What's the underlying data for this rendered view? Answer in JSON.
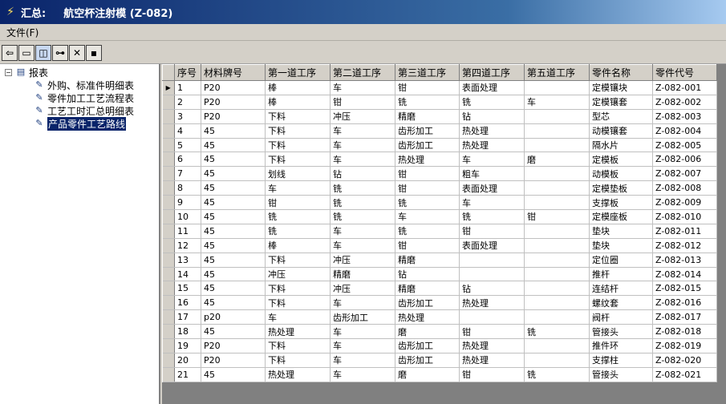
{
  "window": {
    "label": "汇总:",
    "title": "航空杯注射模 (Z-082)"
  },
  "menu": {
    "file": "文件(F)"
  },
  "tree": {
    "root": "报表",
    "children": [
      "外购、标准件明细表",
      "零件加工工艺流程表",
      "工艺工时汇总明细表",
      "产品零件工艺路线"
    ],
    "selected_index": 3
  },
  "grid": {
    "columns": [
      "序号",
      "材料牌号",
      "第一道工序",
      "第二道工序",
      "第三道工序",
      "第四道工序",
      "第五道工序",
      "零件名称",
      "零件代号"
    ],
    "rows": [
      [
        "1",
        "P20",
        "棒",
        "车",
        "钳",
        "表面处理",
        "",
        "定模镶块",
        "Z-082-001"
      ],
      [
        "2",
        "P20",
        "棒",
        "钳",
        "铣",
        "铣",
        "车",
        "定模镶套",
        "Z-082-002"
      ],
      [
        "3",
        "P20",
        "下料",
        "冲压",
        "精磨",
        "钻",
        "",
        "型芯",
        "Z-082-003"
      ],
      [
        "4",
        "45",
        "下料",
        "车",
        "齿形加工",
        "热处理",
        "",
        "动模镶套",
        "Z-082-004"
      ],
      [
        "5",
        "45",
        "下料",
        "车",
        "齿形加工",
        "热处理",
        "",
        "隔水片",
        "Z-082-005"
      ],
      [
        "6",
        "45",
        "下料",
        "车",
        "热处理",
        "车",
        "磨",
        "定模板",
        "Z-082-006"
      ],
      [
        "7",
        "45",
        "划线",
        "钻",
        "钳",
        "粗车",
        "",
        "动模板",
        "Z-082-007"
      ],
      [
        "8",
        "45",
        "车",
        "铣",
        "钳",
        "表面处理",
        "",
        "定模垫板",
        "Z-082-008"
      ],
      [
        "9",
        "45",
        "钳",
        "铣",
        "铣",
        "车",
        "",
        "支撑板",
        "Z-082-009"
      ],
      [
        "10",
        "45",
        "铣",
        "铣",
        "车",
        "铣",
        "钳",
        "定模座板",
        "Z-082-010"
      ],
      [
        "11",
        "45",
        "铣",
        "车",
        "铣",
        "钳",
        "",
        "垫块",
        "Z-082-011"
      ],
      [
        "12",
        "45",
        "棒",
        "车",
        "钳",
        "表面处理",
        "",
        "垫块",
        "Z-082-012"
      ],
      [
        "13",
        "45",
        "下料",
        "冲压",
        "精磨",
        "",
        "",
        "定位圈",
        "Z-082-013"
      ],
      [
        "14",
        "45",
        "冲压",
        "精磨",
        "钻",
        "",
        "",
        "推杆",
        "Z-082-014"
      ],
      [
        "15",
        "45",
        "下料",
        "冲压",
        "精磨",
        "钻",
        "",
        "连结杆",
        "Z-082-015"
      ],
      [
        "16",
        "45",
        "下料",
        "车",
        "齿形加工",
        "热处理",
        "",
        "螺纹套",
        "Z-082-016"
      ],
      [
        "17",
        "p20",
        "车",
        "齿形加工",
        "热处理",
        "",
        "",
        "阀杆",
        "Z-082-017"
      ],
      [
        "18",
        "45",
        "热处理",
        "车",
        "磨",
        "钳",
        "铣",
        "管接头",
        "Z-082-018"
      ],
      [
        "19",
        "P20",
        "下料",
        "车",
        "齿形加工",
        "热处理",
        "",
        "推件环",
        "Z-082-019"
      ],
      [
        "20",
        "P20",
        "下料",
        "车",
        "齿形加工",
        "热处理",
        "",
        "支撑柱",
        "Z-082-020"
      ],
      [
        "21",
        "45",
        "热处理",
        "车",
        "磨",
        "钳",
        "铣",
        "管接头",
        "Z-082-021"
      ]
    ],
    "current_row": 0
  }
}
